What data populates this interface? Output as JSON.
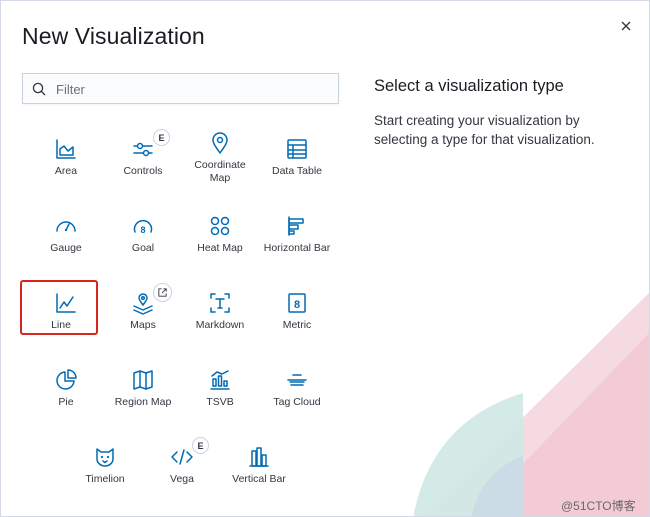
{
  "modal": {
    "title": "New Visualization",
    "close_icon": "close-icon"
  },
  "search": {
    "placeholder": "Filter",
    "value": ""
  },
  "side": {
    "title": "Select a visualization type",
    "description": "Start creating your visualization by selecting a type for that visualization."
  },
  "tiles": {
    "area": "Area",
    "controls": "Controls",
    "coordinate_map_1": "Coordinate",
    "coordinate_map_2": "Map",
    "data_table": "Data Table",
    "gauge": "Gauge",
    "goal": "Goal",
    "heat_map": "Heat Map",
    "horizontal_bar": "Horizontal Bar",
    "line": "Line",
    "maps": "Maps",
    "markdown": "Markdown",
    "metric": "Metric",
    "pie": "Pie",
    "region_map": "Region Map",
    "tsvb": "TSVB",
    "tag_cloud": "Tag Cloud",
    "timelion": "Timelion",
    "vega": "Vega",
    "vertical_bar": "Vertical Bar"
  },
  "badges": {
    "experimental": "E"
  },
  "watermark": "@51CTO博客",
  "colors": {
    "accent": "#006bb4",
    "selected_border": "#d8261f",
    "deco_pink": "#f2c4cf",
    "deco_teal": "#cfe8e4"
  }
}
